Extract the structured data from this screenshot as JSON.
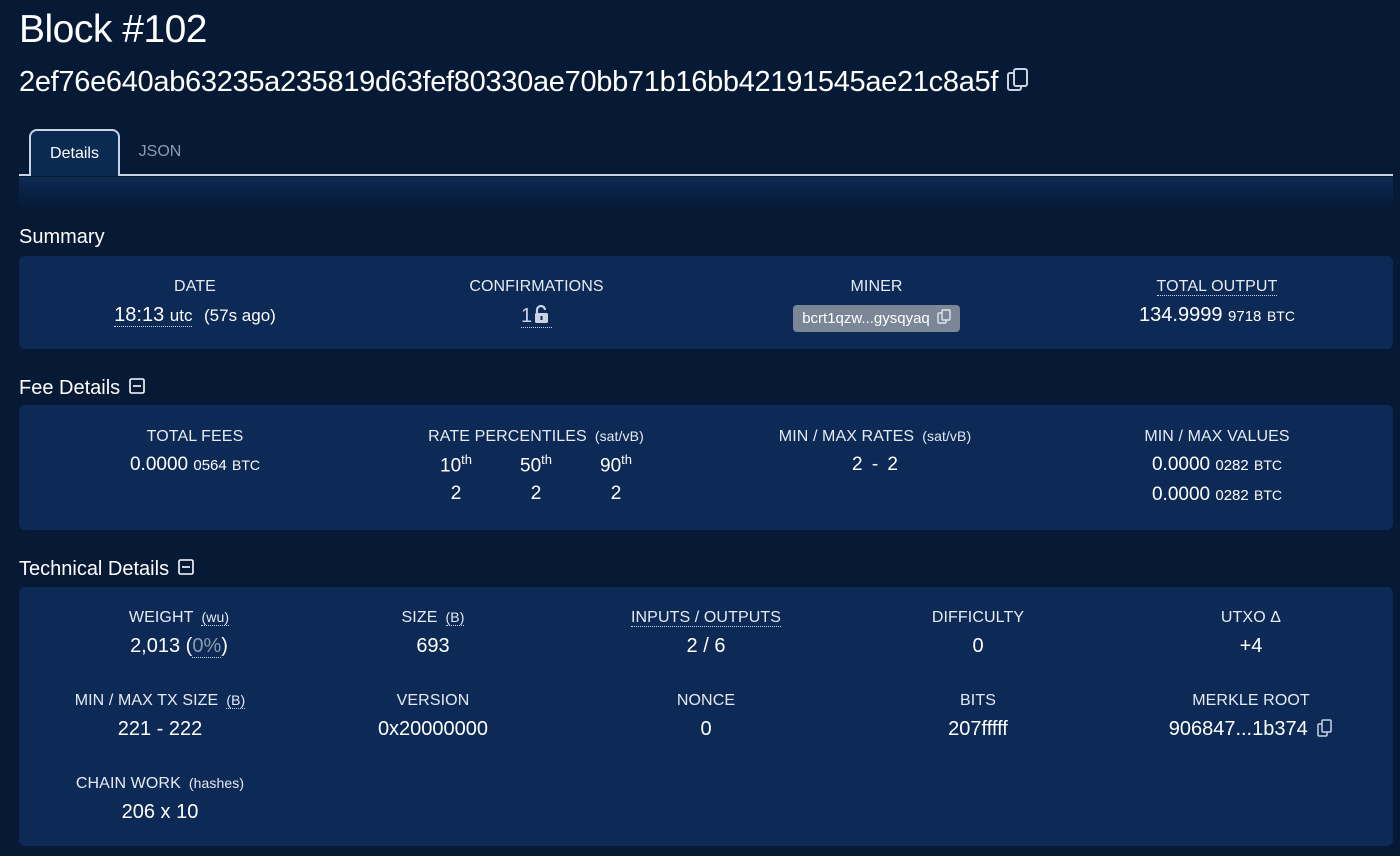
{
  "header": {
    "title": "Block #102",
    "hash": "2ef76e640ab63235a235819d63fef80330ae70bb71b16bb42191545ae21c8a5f"
  },
  "tabs": [
    {
      "label": "Details",
      "active": true
    },
    {
      "label": "JSON",
      "active": false
    }
  ],
  "summary": {
    "title": "Summary",
    "date": {
      "label": "DATE",
      "time": "18:13",
      "tz": "utc",
      "ago": "(57s ago)"
    },
    "confirmations": {
      "label": "CONFIRMATIONS",
      "value": "1"
    },
    "miner": {
      "label": "MINER",
      "value": "bcrt1qzw...gysqyaq"
    },
    "total_output": {
      "label": "TOTAL OUTPUT",
      "main": "134.9999",
      "small": "9718",
      "unit": "BTC"
    }
  },
  "fees": {
    "title": "Fee Details",
    "total_fees": {
      "label": "TOTAL FEES",
      "main": "0.0000",
      "small": "0564",
      "unit": "BTC"
    },
    "rate_percentiles": {
      "label": "RATE PERCENTILES",
      "unit": "(sat/vB)",
      "items": [
        {
          "pct": "10",
          "suffix": "th",
          "value": "2"
        },
        {
          "pct": "50",
          "suffix": "th",
          "value": "2"
        },
        {
          "pct": "90",
          "suffix": "th",
          "value": "2"
        }
      ]
    },
    "min_max_rates": {
      "label": "MIN / MAX RATES",
      "unit": "(sat/vB)",
      "value": "2 - 2"
    },
    "min_max_values": {
      "label": "MIN / MAX VALUES",
      "min": {
        "main": "0.0000",
        "small": "0282",
        "unit": "BTC"
      },
      "max": {
        "main": "0.0000",
        "small": "0282",
        "unit": "BTC"
      }
    }
  },
  "technical": {
    "title": "Technical Details",
    "weight": {
      "label": "WEIGHT",
      "unit": "(wu)",
      "value": "2,013",
      "pct": "0%"
    },
    "size": {
      "label": "SIZE",
      "unit": "(B)",
      "value": "693"
    },
    "inputs_outputs": {
      "label": "INPUTS / OUTPUTS",
      "value": "2 / 6"
    },
    "difficulty": {
      "label": "DIFFICULTY",
      "value": "0"
    },
    "utxo_delta": {
      "label": "UTXO Δ",
      "value": "+4"
    },
    "min_max_tx_size": {
      "label": "MIN / MAX TX SIZE",
      "unit": "(B)",
      "value": "221 - 222"
    },
    "version": {
      "label": "VERSION",
      "value": "0x20000000"
    },
    "nonce": {
      "label": "NONCE",
      "value": "0"
    },
    "bits": {
      "label": "BITS",
      "value": "207fffff"
    },
    "merkle_root": {
      "label": "MERKLE ROOT",
      "value": "906847...1b374"
    },
    "chain_work": {
      "label": "CHAIN WORK",
      "unit": "(hashes)",
      "value": "206 x 10"
    }
  },
  "colors": {
    "background": "#061a36",
    "panel": "#0c2a55",
    "chip": "#7b8797"
  }
}
